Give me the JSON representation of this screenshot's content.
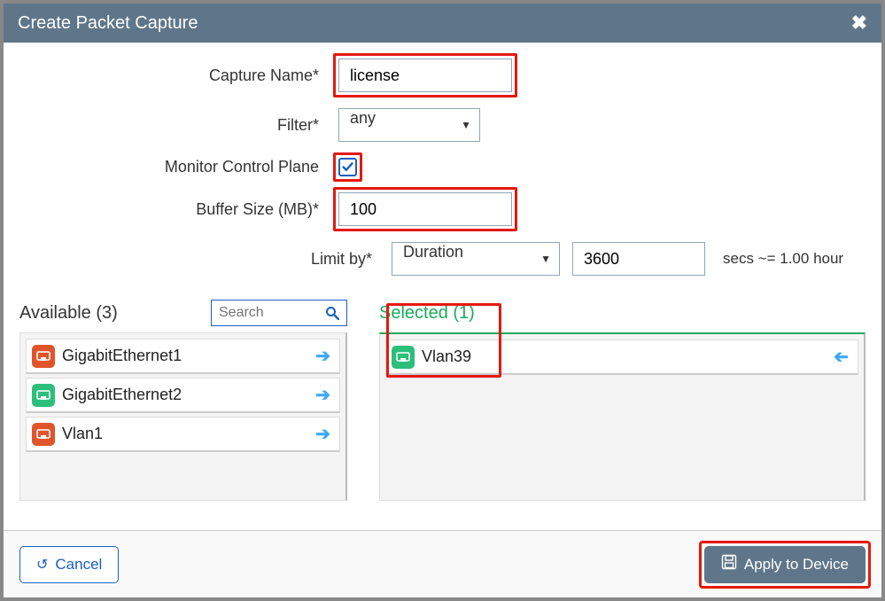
{
  "header": {
    "title": "Create Packet Capture"
  },
  "form": {
    "captureName": {
      "label": "Capture Name*",
      "value": "license"
    },
    "filter": {
      "label": "Filter*",
      "value": "any"
    },
    "monitorControlPlane": {
      "label": "Monitor Control Plane",
      "checked": true
    },
    "bufferSize": {
      "label": "Buffer Size (MB)*",
      "value": "100"
    },
    "limitBy": {
      "label": "Limit by*",
      "mode": "Duration",
      "value": "3600",
      "hint": "secs ~= 1.00 hour"
    }
  },
  "available": {
    "title": "Available (3)",
    "searchPlaceholder": "Search",
    "items": [
      {
        "name": "GigabitEthernet1",
        "color": "orange"
      },
      {
        "name": "GigabitEthernet2",
        "color": "green"
      },
      {
        "name": "Vlan1",
        "color": "orange"
      }
    ]
  },
  "selected": {
    "title": "Selected (1)",
    "items": [
      {
        "name": "Vlan39",
        "color": "green"
      }
    ]
  },
  "footer": {
    "cancel": "Cancel",
    "apply": "Apply to Device"
  }
}
